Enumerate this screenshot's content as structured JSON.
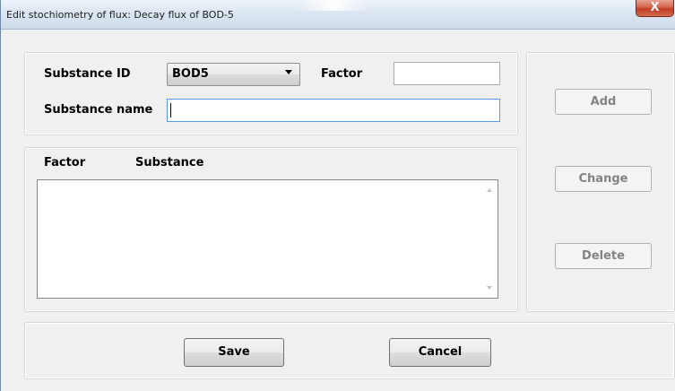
{
  "window": {
    "title": "Edit stochiometry of flux: Decay flux of BOD-5",
    "close_glyph": "X"
  },
  "form": {
    "substance_id_label": "Substance ID",
    "substance_id_value": "BOD5",
    "factor_label": "Factor",
    "factor_value": "",
    "substance_name_label": "Substance name",
    "substance_name_value": ""
  },
  "list": {
    "columns": [
      "Factor",
      "Substance"
    ],
    "rows": []
  },
  "actions": {
    "add": "Add",
    "change": "Change",
    "delete": "Delete"
  },
  "footer": {
    "save": "Save",
    "cancel": "Cancel"
  },
  "colors": {
    "title_bar": "#dbe6f2",
    "close_button": "#c13c22",
    "dialog_background": "#f0f0f0",
    "focus_border": "#569de5"
  },
  "icons": {
    "combo": "chevron-down-icon",
    "scroll_up": "scroll-up-icon",
    "scroll_down": "scroll-down-icon",
    "close": "close-icon"
  }
}
